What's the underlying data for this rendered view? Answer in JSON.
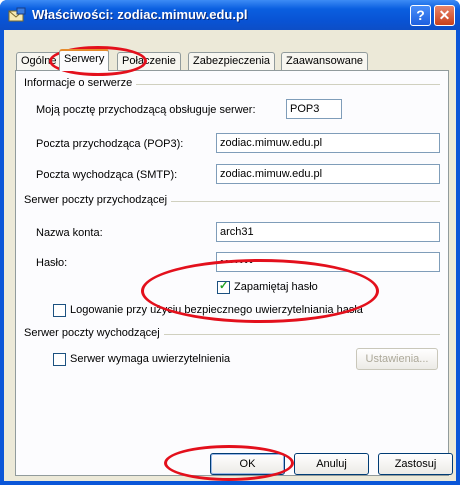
{
  "window": {
    "title": "Właściwości: zodiac.mimuw.edu.pl",
    "help_label": "?",
    "close_label": "✕"
  },
  "tabs": [
    {
      "label": "Ogólne",
      "active": false
    },
    {
      "label": "Serwery",
      "active": true
    },
    {
      "label": "Połączenie",
      "active": false
    },
    {
      "label": "Zabezpieczenia",
      "active": false
    },
    {
      "label": "Zaawansowane",
      "active": false
    }
  ],
  "server_info": {
    "group_label": "Informacje o serwerze",
    "incoming_type_label": "Moją pocztę przychodzącą obsługuje serwer:",
    "incoming_type_value": "POP3",
    "incoming_label": "Poczta przychodząca (POP3):",
    "incoming_value": "zodiac.mimuw.edu.pl",
    "outgoing_label": "Poczta wychodząca (SMTP):",
    "outgoing_value": "zodiac.mimuw.edu.pl"
  },
  "incoming_server": {
    "group_label": "Serwer poczty przychodzącej",
    "account_label": "Nazwa konta:",
    "account_value": "arch31",
    "password_label": "Hasło:",
    "password_value": "•••••••",
    "remember_label": "Zapamiętaj hasło",
    "remember_checked": true,
    "spa_label": "Logowanie przy użyciu bezpiecznego uwierzytelniania hasła",
    "spa_checked": false
  },
  "outgoing_server": {
    "group_label": "Serwer poczty wychodzącej",
    "auth_label": "Serwer wymaga uwierzytelnienia",
    "auth_checked": false,
    "settings_button": "Ustawienia..."
  },
  "buttons": {
    "ok": "OK",
    "cancel": "Anuluj",
    "apply": "Zastosuj"
  },
  "colors": {
    "title_bar": "#0a5fe0",
    "annotation": "#e3101c",
    "dialog_bg": "#ece9d8"
  }
}
